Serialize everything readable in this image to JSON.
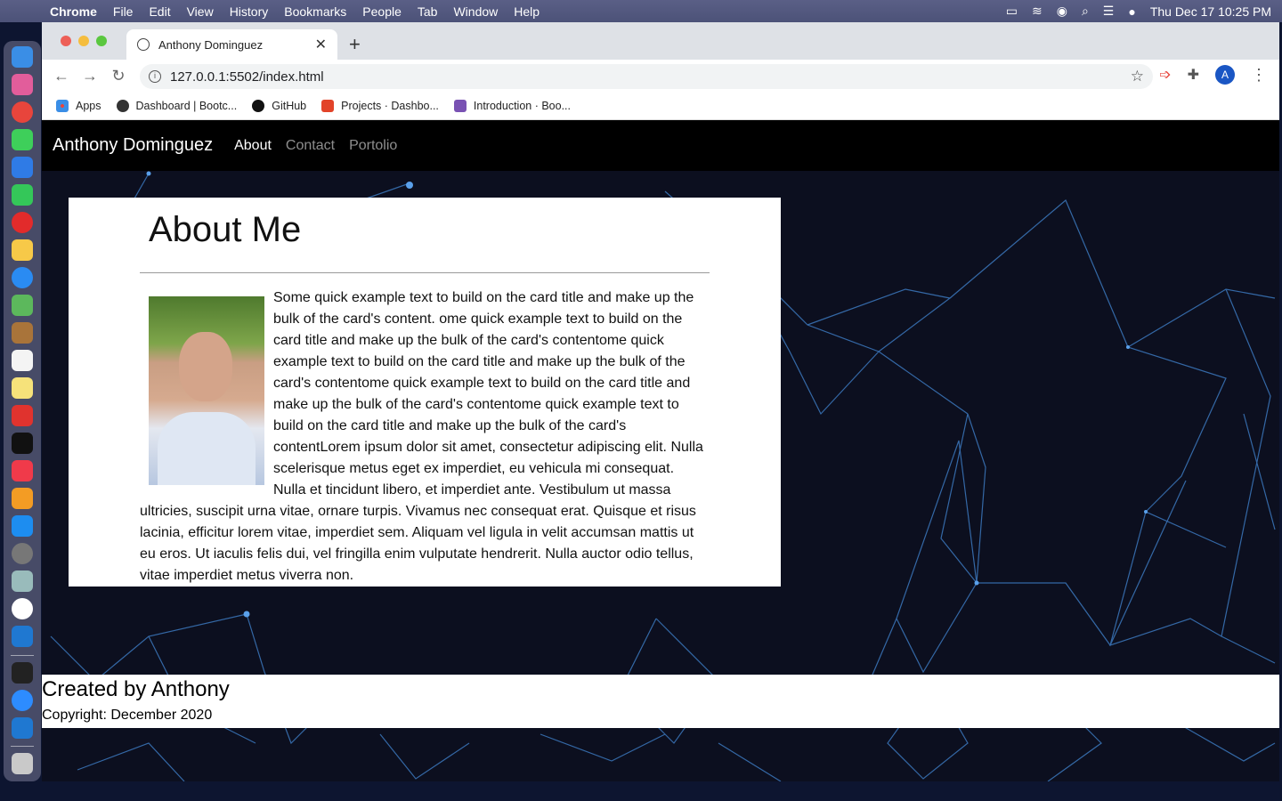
{
  "menubar": {
    "app": "Chrome",
    "items": [
      "File",
      "Edit",
      "View",
      "History",
      "Bookmarks",
      "People",
      "Tab",
      "Window",
      "Help"
    ],
    "datetime": "Thu Dec 17  10:25 PM"
  },
  "browser": {
    "tab_title": "Anthony Dominguez",
    "url": "127.0.0.1:5502/index.html",
    "profile_initial": "A",
    "bookmarks": [
      "Apps",
      "Dashboard | Bootc...",
      "GitHub",
      "Projects · Dashbo...",
      "Introduction · Boo..."
    ]
  },
  "site": {
    "brand": "Anthony Dominguez",
    "nav": [
      "About",
      "Contact",
      "Portolio"
    ],
    "heading": "About Me",
    "body": "Some quick example text to build on the card title and make up the bulk of the card's content. ome quick example text to build on the card title and make up the bulk of the card's contentome quick example text to build on the card title and make up the bulk of the card's contentome quick example text to build on the card title and make up the bulk of the card's contentome quick example text to build on the card title and make up the bulk of the card's contentLorem ipsum dolor sit amet, consectetur adipiscing elit. Nulla scelerisque metus eget ex imperdiet, eu vehicula mi consequat. Nulla et tincidunt libero, et imperdiet ante. Vestibulum ut massa ultricies, suscipit urna vitae, ornare turpis. Vivamus nec consequat erat. Quisque et risus lacinia, efficitur lorem vitae, imperdiet sem. Aliquam vel ligula in velit accumsan mattis ut eu eros. Ut iaculis felis dui, vel fringilla enim vulputate hendrerit. Nulla auctor odio tellus, vitae imperdiet metus viverra non.",
    "footer_title": "Created by Anthony",
    "footer_copyright": "Copyright: December 2020"
  },
  "colors": {
    "nav_bg": "#000000",
    "page_bg": "#0c0f1f",
    "network_line": "#4a90d9"
  }
}
